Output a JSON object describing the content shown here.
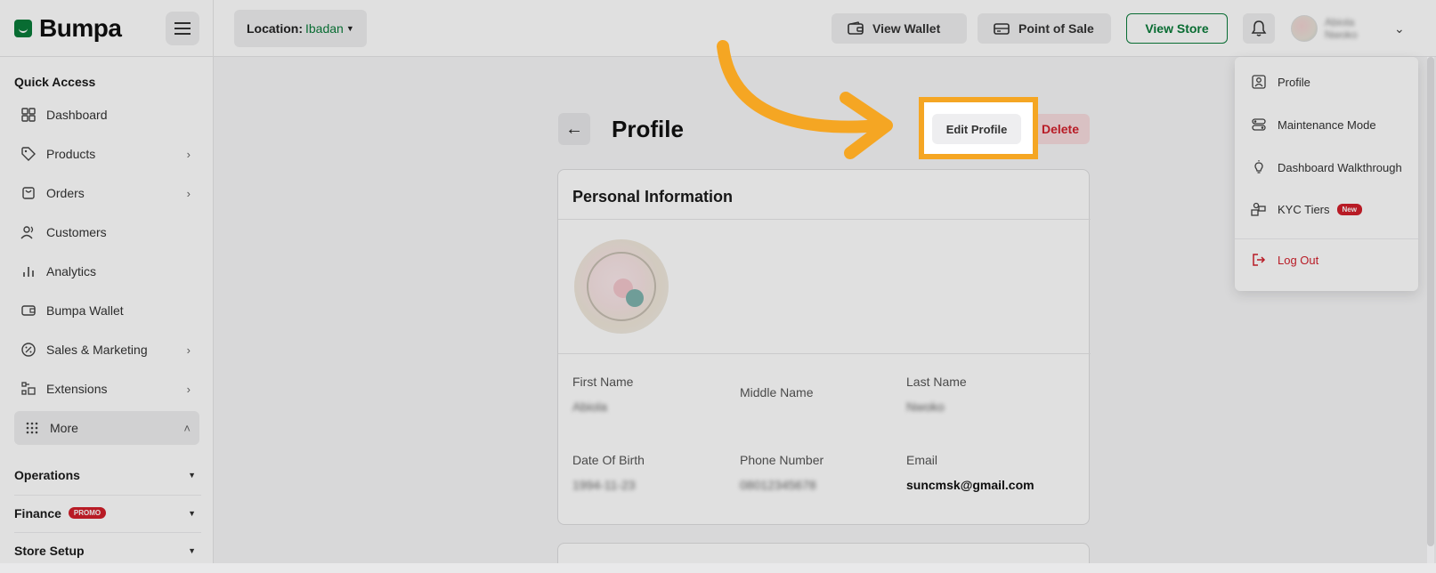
{
  "brand": {
    "name": "Bumpa"
  },
  "header": {
    "location_label": "Location:",
    "location_value": "Ibadan",
    "view_wallet": "View Wallet",
    "point_of_sale": "Point of Sale",
    "view_store": "View Store",
    "user_name": "Abiola Nwoko"
  },
  "sidebar": {
    "quick_access": "Quick Access",
    "items": [
      {
        "label": "Dashboard",
        "icon": "grid-icon"
      },
      {
        "label": "Products",
        "icon": "tag-icon"
      },
      {
        "label": "Orders",
        "icon": "orders-icon"
      },
      {
        "label": "Customers",
        "icon": "users-icon"
      },
      {
        "label": "Analytics",
        "icon": "bar-chart-icon"
      },
      {
        "label": "Bumpa Wallet",
        "icon": "wallet-icon"
      },
      {
        "label": "Sales & Marketing",
        "icon": "percent-icon"
      },
      {
        "label": "Extensions",
        "icon": "extensions-icon"
      },
      {
        "label": "More",
        "icon": "dots-grid-icon"
      }
    ],
    "sections": [
      {
        "label": "Operations"
      },
      {
        "label": "Finance",
        "badge": "PROMO"
      },
      {
        "label": "Store Setup"
      }
    ]
  },
  "main": {
    "title": "Profile",
    "edit_profile": "Edit Profile",
    "delete": "Delete",
    "personal_information": "Personal Information",
    "fields": {
      "first_name_label": "First Name",
      "first_name_value": "Abiola",
      "middle_name_label": "Middle Name",
      "last_name_label": "Last Name",
      "last_name_value": "Nwoko",
      "dob_label": "Date Of Birth",
      "dob_value": "1994-11-23",
      "phone_label": "Phone Number",
      "phone_value": "08012345678",
      "email_label": "Email",
      "email_value": "suncmsk@gmail.com"
    }
  },
  "dropdown": {
    "items": [
      {
        "label": "Profile",
        "icon": "profile-icon"
      },
      {
        "label": "Maintenance Mode",
        "icon": "toggle-icon"
      },
      {
        "label": "Dashboard Walkthrough",
        "icon": "lightbulb-icon"
      },
      {
        "label": "KYC Tiers",
        "icon": "kyc-icon",
        "badge": "New"
      }
    ],
    "logout": "Log Out"
  },
  "colors": {
    "brand_green": "#0a7b39",
    "danger": "#d21f2b",
    "highlight": "#f5a623"
  }
}
